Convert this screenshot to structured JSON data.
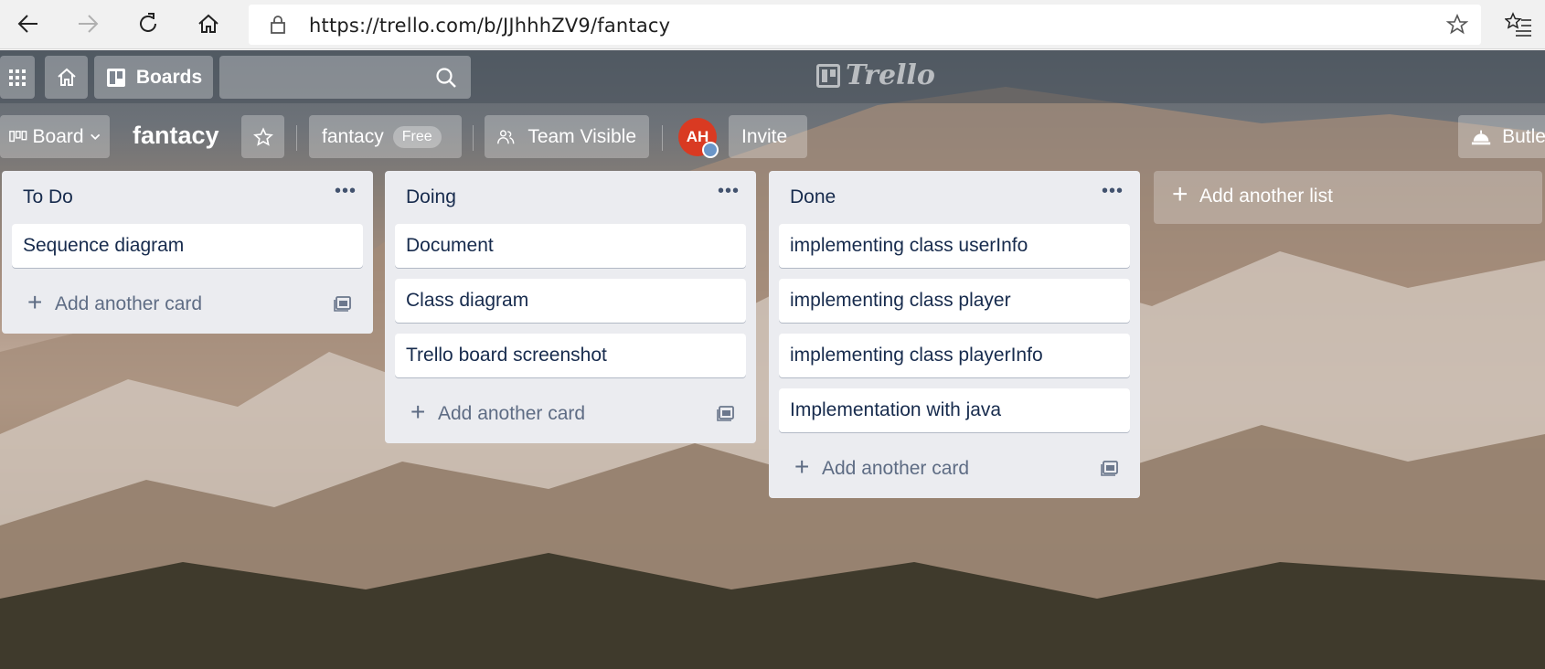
{
  "browser": {
    "url": "https://trello.com/b/JJhhhZV9/fantacy",
    "icons": [
      "back-icon",
      "forward-icon",
      "refresh-icon",
      "home-icon",
      "lock-icon",
      "star-icon",
      "favorites-icon"
    ]
  },
  "topnav": {
    "boards_label": "Boards",
    "search_placeholder": "",
    "logo_text": "Trello"
  },
  "board_header": {
    "view_label": "Board",
    "title": "fantacy",
    "team_name": "fantacy",
    "plan_badge": "Free",
    "visibility_label": "Team Visible",
    "avatar_initials": "AH",
    "invite_label": "Invite",
    "butler_label": "Butle"
  },
  "lists": [
    {
      "title": "To Do",
      "cards": [
        "Sequence diagram"
      ],
      "add_card_label": "Add another card"
    },
    {
      "title": "Doing",
      "cards": [
        "Document",
        "Class diagram",
        "Trello board screenshot"
      ],
      "add_card_label": "Add another card"
    },
    {
      "title": "Done",
      "cards": [
        "implementing class userInfo",
        "implementing class player",
        "implementing class playerInfo",
        "Implementation with java"
      ],
      "add_card_label": "Add another card"
    }
  ],
  "add_list_label": "Add another list",
  "colors": {
    "avatar": "#d93a22",
    "list_bg": "#ebecf0",
    "card_text": "#172b4d"
  }
}
